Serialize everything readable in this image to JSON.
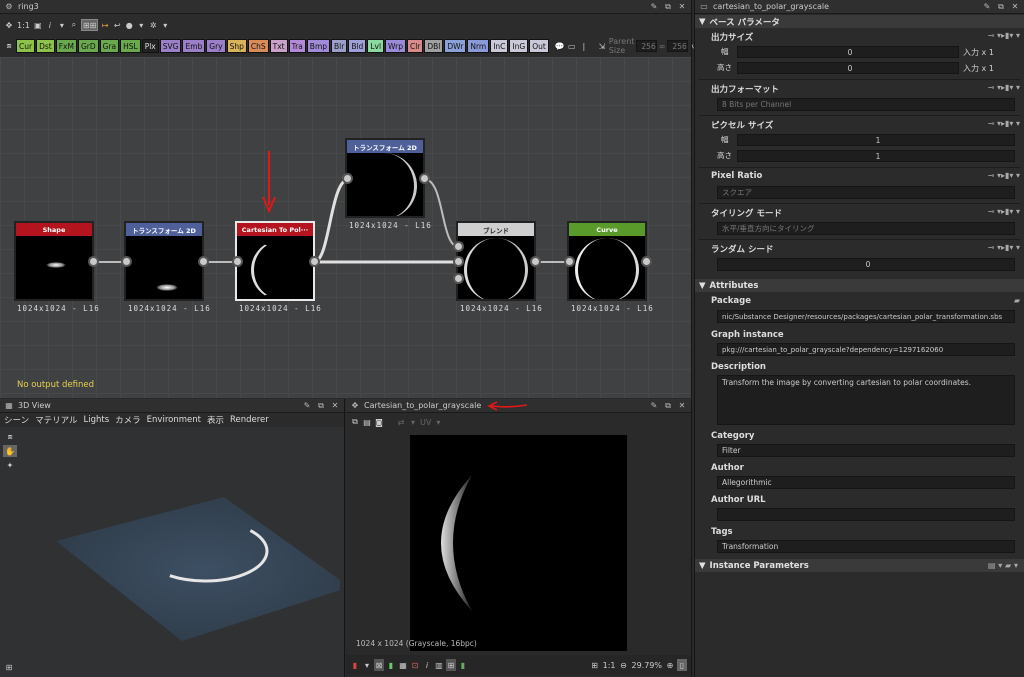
{
  "graph_panel": {
    "title": "ring3",
    "zoom_label": "1:1",
    "parent_size_label": "Parent Size",
    "parent_size_w": "256",
    "parent_size_h": "256",
    "filter_buttons": [
      {
        "label": "Cur",
        "color": "#8ec34a"
      },
      {
        "label": "Dst",
        "color": "#8ec34a"
      },
      {
        "label": "FxM",
        "color": "#6aa84f"
      },
      {
        "label": "GrD",
        "color": "#6aa84f"
      },
      {
        "label": "Gra",
        "color": "#6aa84f"
      },
      {
        "label": "HSL",
        "color": "#6aa84f"
      },
      {
        "label": "Plx",
        "color": "#222222"
      },
      {
        "label": "SVG",
        "color": "#9b7fc9"
      },
      {
        "label": "Emb",
        "color": "#9b7fc9"
      },
      {
        "label": "Gry",
        "color": "#9b7fc9"
      },
      {
        "label": "Shp",
        "color": "#d9b35a"
      },
      {
        "label": "ChS",
        "color": "#d98c5a"
      },
      {
        "label": "Txt",
        "color": "#c9a0c9"
      },
      {
        "label": "Tra",
        "color": "#b38ad9"
      },
      {
        "label": "Bmp",
        "color": "#a08ad9"
      },
      {
        "label": "Blr",
        "color": "#9aa0c9"
      },
      {
        "label": "Bld",
        "color": "#a0a0d9"
      },
      {
        "label": "Lvl",
        "color": "#8ad9a0"
      },
      {
        "label": "Wrp",
        "color": "#9a8ad9"
      },
      {
        "label": "Clr",
        "color": "#d98a8a"
      },
      {
        "label": "DBl",
        "color": "#a0a0a0"
      },
      {
        "label": "DWr",
        "color": "#8aa0d9"
      },
      {
        "label": "Nrm",
        "color": "#8a9ad9"
      },
      {
        "label": "InC",
        "color": "#c9c9d9"
      },
      {
        "label": "InG",
        "color": "#c9c9d9"
      },
      {
        "label": "Out",
        "color": "#c9c9d9"
      }
    ],
    "status": "No output defined",
    "nodes": [
      {
        "title": "Shape",
        "header_color": "#b3141e",
        "label": "1024x1024 - L16"
      },
      {
        "title": "トランスフォーム 2D",
        "header_color": "#4e5f9a",
        "label": "1024x1024 - L16"
      },
      {
        "title": "Cartesian To Pol···",
        "header_color": "#b3141e",
        "label": "1024x1024 - L16"
      },
      {
        "title": "トランスフォーム 2D",
        "header_color": "#4e5f9a",
        "label": "1024x1024 - L16"
      },
      {
        "title": "ブレンド",
        "header_color": "#cfcfcf",
        "label": "1024x1024 - L16"
      },
      {
        "title": "Curve",
        "header_color": "#5a9a2a",
        "label": "1024x1024 - L16"
      }
    ]
  },
  "view3d": {
    "title": "3D View",
    "menu": [
      "シーン",
      "マテリアル",
      "Lights",
      "カメラ",
      "Environment",
      "表示",
      "Renderer"
    ]
  },
  "view2d": {
    "title": "Cartesian_to_polar_grayscale",
    "uv_label": "UV",
    "info": "1024 x 1024 (Grayscale, 16bpc)",
    "zoom_ratio": "1:1",
    "zoom_percent": "29.79%"
  },
  "props": {
    "title": "cartesian_to_polar_grayscale",
    "base_section": "ベース パラメータ",
    "output_size": "出力サイズ",
    "width_label": "幅",
    "height_label": "高さ",
    "output_w": "0",
    "output_h": "0",
    "input_x1": "入力 x 1",
    "output_format": "出力フォーマット",
    "output_format_value": "8 Bits per Channel",
    "pixel_size": "ピクセル サイズ",
    "pixel_w": "1",
    "pixel_h": "1",
    "pixel_ratio": "Pixel Ratio",
    "pixel_ratio_value": "スクエア",
    "tiling_mode": "タイリング モード",
    "tiling_value": "水平/垂直方向にタイリング",
    "random_seed": "ランダム シード",
    "random_seed_value": "0",
    "attributes_section": "Attributes",
    "package": "Package",
    "package_value": "nic/Substance Designer/resources/packages/cartesian_polar_transformation.sbs",
    "graph_instance": "Graph instance",
    "graph_instance_value": "pkg:///cartesian_to_polar_grayscale?dependency=1297162060",
    "description": "Description",
    "description_value": "Transform the image by converting cartesian to polar coordinates.",
    "category": "Category",
    "category_value": "Filter",
    "author": "Author",
    "author_value": "Allegorithmic",
    "author_url": "Author URL",
    "author_url_value": "",
    "tags": "Tags",
    "tags_value": "Transformation",
    "instance_section": "Instance Parameters"
  }
}
